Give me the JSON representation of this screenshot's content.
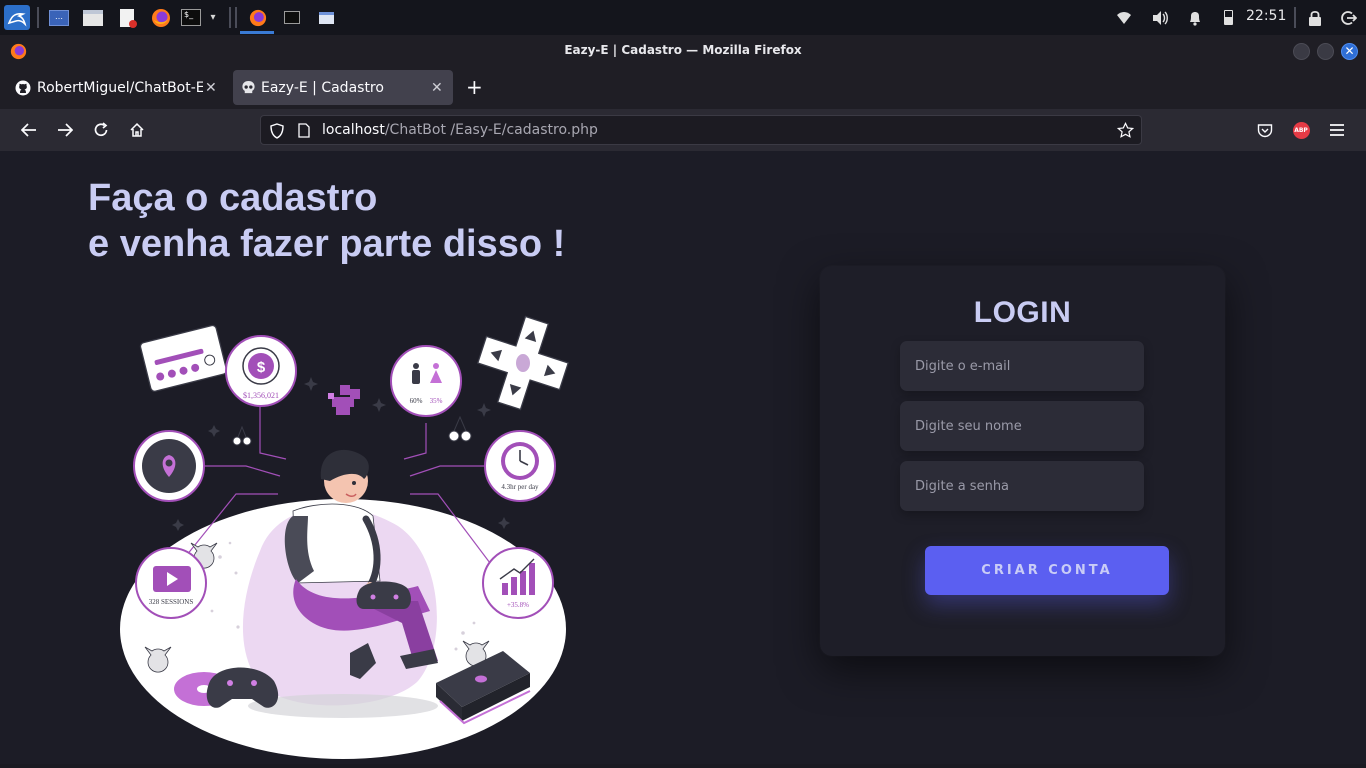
{
  "panel": {
    "apps": [
      "kali-menu-icon",
      "workspace-icon",
      "file-manager-icon",
      "text-editor-icon",
      "firefox-icon",
      "terminal-icon",
      "chevron-down-icon"
    ],
    "tasks": [
      "firefox-task-icon",
      "terminal-task-icon",
      "window-task-icon"
    ],
    "clock": "22:51"
  },
  "window": {
    "title": "Eazy-E | Cadastro — Mozilla Firefox"
  },
  "tabs": [
    {
      "label": "RobertMiguel/ChatBot-Ea",
      "icon": "github-icon",
      "active": false
    },
    {
      "label": "Eazy-E | Cadastro",
      "icon": "skull-icon",
      "active": true
    }
  ],
  "navbar": {
    "url_host": "localhost",
    "url_path": "/ChatBot /Easy-E/cadastro.php",
    "extension_badge": "ABP"
  },
  "page": {
    "headline_line1": "Faça o cadastro",
    "headline_line2": "e venha fazer parte disso !",
    "illustration": {
      "money_label": "$1,356,021",
      "gender_male": "60%",
      "gender_female": "35%",
      "time_label": "4.3hr per day",
      "sessions_label": "328 SESSIONS",
      "growth_label": "+35.8%"
    }
  },
  "form": {
    "title": "LOGIN",
    "email_placeholder": "Digite o e-mail",
    "name_placeholder": "Digite seu nome",
    "password_placeholder": "Digite a senha",
    "submit_label": "CRIAR CONTA"
  },
  "colors": {
    "accent": "#5b5ff1",
    "headline": "#c9ccf3",
    "page_bg": "#1c1c26",
    "card_bg": "#1e1e28",
    "illustration_purple": "#a24fb8"
  }
}
